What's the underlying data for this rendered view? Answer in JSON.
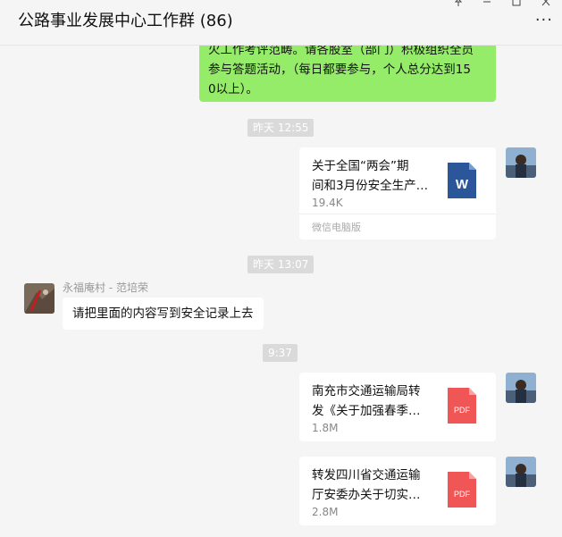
{
  "window": {
    "title": "公路事业发展中心工作群 (86)",
    "more_label": "···"
  },
  "messages": {
    "green_top": {
      "lines": [
        "火工作考评范畴。请各股室（部门）积极组织全员",
        "参与答题活动，（每日都要参与，个人总分达到15",
        "0以上）。"
      ]
    },
    "ts1": "昨天 12:55",
    "file1": {
      "name_l1": "关于全国“两会”期",
      "name_l2": "间和3月份安全生产…",
      "size": "19.4K",
      "source": "微信电脑版",
      "icon_label": "W",
      "icon_color": "#2b579a"
    },
    "ts2": "昨天 13:07",
    "incoming": {
      "sender": "永福庵村 - 范培荣",
      "text": "请把里面的内容写到安全记录上去"
    },
    "ts3": "9:37",
    "file2": {
      "name_l1": "南充市交通运输局转",
      "name_l2": "发《关于加强春季…",
      "size": "1.8M",
      "icon_label": "PDF",
      "icon_color": "#f05656"
    },
    "file3": {
      "name_l1": "转发四川省交通运输",
      "name_l2": "厅安委办关于切实…",
      "size": "2.8M",
      "icon_label": "PDF",
      "icon_color": "#f05656"
    }
  }
}
